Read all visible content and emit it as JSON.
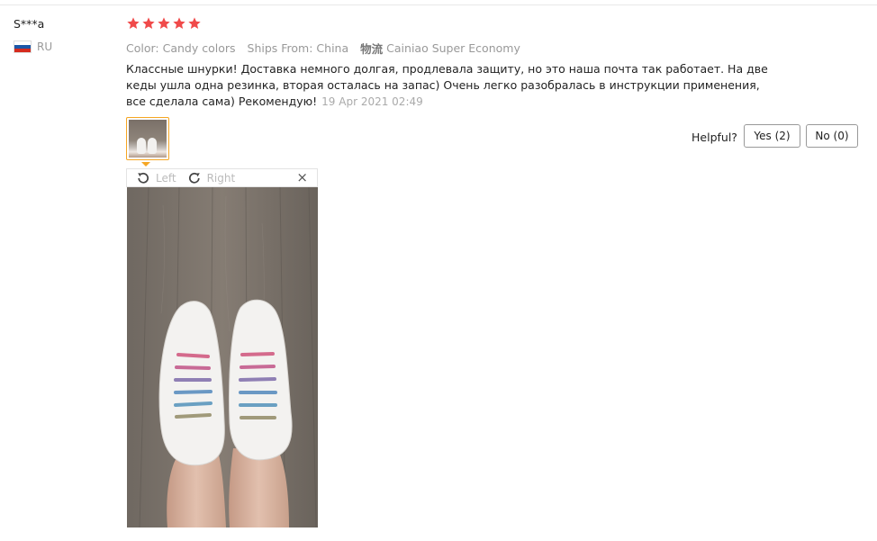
{
  "reviewer": {
    "name": "S***a",
    "country_code": "RU",
    "flag_colors": [
      "#ffffff",
      "#1c57a7",
      "#d52b1e"
    ]
  },
  "rating": {
    "stars": 5,
    "max": 5,
    "color": "#f04a4a"
  },
  "meta": {
    "color_label": "Color: Candy colors",
    "ships_label": "Ships From: China",
    "logistics_icon": "物流",
    "logistics_label": "Cainiao Super Economy"
  },
  "review": {
    "text": "Классные шнурки! Доставка немного долгая, продлевала защиту, но это наша почта так работает. На две кеды ушла одна резинка, вторая осталась на запас) Очень легко разобралась в инструкции применения, все сделала сама) Рекомендую!",
    "date": "19 Apr 2021 02:49"
  },
  "feedback": {
    "helpful_label": "Helpful?",
    "yes_label": "Yes (2)",
    "no_label": "No (0)"
  },
  "viewer": {
    "rotate_left_label": "Left",
    "rotate_right_label": "Right",
    "close_glyph": "×",
    "accent": "#f5a623"
  }
}
